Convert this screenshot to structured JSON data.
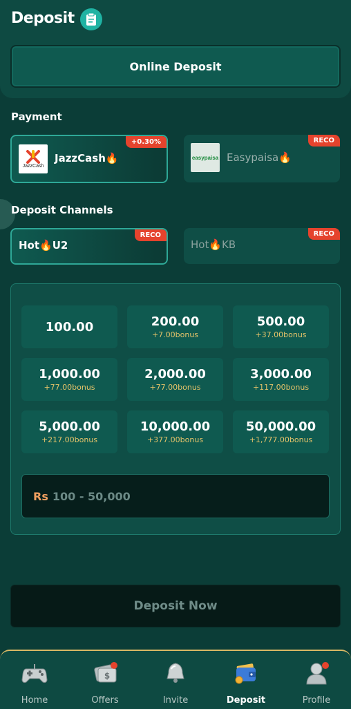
{
  "header": {
    "title": "Deposit",
    "icon": "clipboard-icon"
  },
  "online_deposit": {
    "label": "Online Deposit"
  },
  "payment": {
    "label": "Payment",
    "methods": [
      {
        "name": "JazzCash🔥",
        "badge": "+0.30%",
        "logo_text": "JazzCash",
        "selected": true
      },
      {
        "name": "Easypaisa🔥",
        "badge": "RECO",
        "logo_text": "easypaisa",
        "selected": false
      }
    ]
  },
  "channels": {
    "label": "Deposit Channels",
    "items": [
      {
        "name": "Hot🔥U2",
        "badge": "RECO",
        "selected": true
      },
      {
        "name": "Hot🔥KB",
        "badge": "RECO",
        "selected": false
      }
    ]
  },
  "amounts": [
    {
      "value": "100.00",
      "bonus": ""
    },
    {
      "value": "200.00",
      "bonus": "+7.00bonus"
    },
    {
      "value": "500.00",
      "bonus": "+37.00bonus"
    },
    {
      "value": "1,000.00",
      "bonus": "+77.00bonus"
    },
    {
      "value": "2,000.00",
      "bonus": "+77.00bonus"
    },
    {
      "value": "3,000.00",
      "bonus": "+117.00bonus"
    },
    {
      "value": "5,000.00",
      "bonus": "+217.00bonus"
    },
    {
      "value": "10,000.00",
      "bonus": "+377.00bonus"
    },
    {
      "value": "50,000.00",
      "bonus": "+1,777.00bonus"
    }
  ],
  "amount_input": {
    "currency": "Rs",
    "placeholder": "100 - 50,000"
  },
  "deposit_button": {
    "label": "Deposit Now"
  },
  "nav": [
    {
      "label": "Home",
      "icon": "gamepad-icon",
      "active": false,
      "dot": false
    },
    {
      "label": "Offers",
      "icon": "gift-card-icon",
      "active": false,
      "dot": true
    },
    {
      "label": "Invite",
      "icon": "bell-icon",
      "active": false,
      "dot": false
    },
    {
      "label": "Deposit",
      "icon": "wallet-icon",
      "active": true,
      "dot": false
    },
    {
      "label": "Profile",
      "icon": "user-icon",
      "active": false,
      "dot": true
    }
  ],
  "colors": {
    "accent": "#1fb3a3",
    "badge": "#e5432d",
    "bonus": "#e7c46a",
    "nav_border": "#d9b864"
  }
}
